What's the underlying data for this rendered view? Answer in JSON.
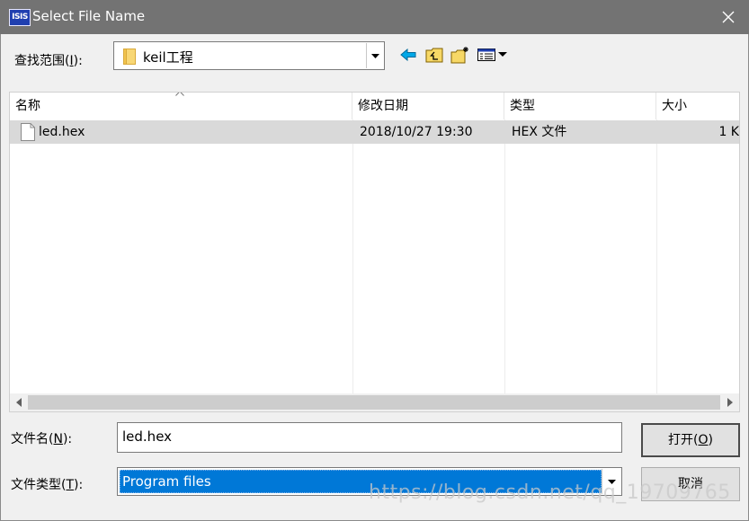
{
  "window": {
    "title": "Select File Name",
    "app_icon_text": "ISIS"
  },
  "look_in": {
    "label_prefix": "查找范围(",
    "label_key": "I",
    "label_suffix": "):",
    "value": "keil工程"
  },
  "list": {
    "columns": [
      "名称",
      "修改日期",
      "类型",
      "大小"
    ],
    "rows": [
      {
        "name": "led.hex",
        "modified": "2018/10/27 19:30",
        "type": "HEX 文件",
        "size": "1 K"
      }
    ]
  },
  "filename": {
    "label_prefix": "文件名(",
    "label_key": "N",
    "label_suffix": "):",
    "value": "led.hex"
  },
  "filetype": {
    "label_prefix": "文件类型(",
    "label_key": "T",
    "label_suffix": "):",
    "value": "Program files"
  },
  "buttons": {
    "open_prefix": "打开(",
    "open_key": "O",
    "open_suffix": ")",
    "cancel": "取消"
  },
  "watermark": "https://blog.csdn.net/qq_19709765",
  "icons": {
    "back": "back-arrow-icon",
    "up": "up-folder-icon",
    "new_folder": "new-folder-icon",
    "view_menu": "view-menu-icon"
  },
  "colors": {
    "titlebar": "#737373",
    "selection": "#0078d7",
    "row_highlight": "#d9d9d9"
  }
}
